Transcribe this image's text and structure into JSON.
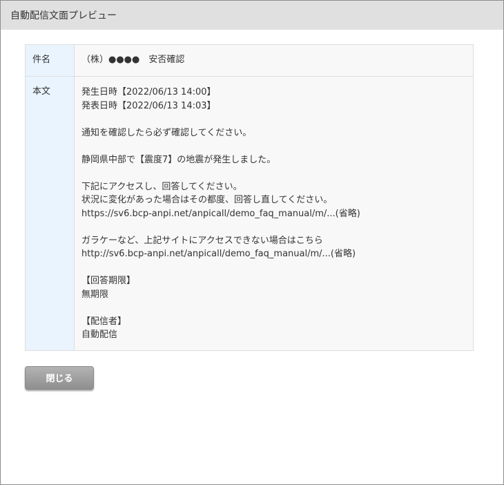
{
  "window": {
    "title": "自動配信文面プレビュー"
  },
  "preview": {
    "subject_label": "件名",
    "subject_value": "（株）●●●●　安否確認",
    "body_label": "本文",
    "body_value": "発生日時【2022/06/13 14:00】\n発表日時【2022/06/13 14:03】\n\n通知を確認したら必ず確認してください。\n\n静岡県中部で【震度7】の地震が発生しました。\n\n下記にアクセスし、回答してください。\n状況に変化があった場合はその都度、回答し直してください。\nhttps://sv6.bcp-anpi.net/anpicall/demo_faq_manual/m/...(省略)\n\nガラケーなど、上記サイトにアクセスできない場合はこちら\nhttp://sv6.bcp-anpi.net/anpicall/demo_faq_manual/m/...(省略)\n\n【回答期限】\n無期限\n\n【配信者】\n自動配信"
  },
  "actions": {
    "close_label": "閉じる"
  },
  "colors": {
    "titlebar": "#e0e0e0",
    "label_cell": "#eaf4ff",
    "value_cell": "#f8f8f8",
    "button": "#9e9e9e"
  }
}
